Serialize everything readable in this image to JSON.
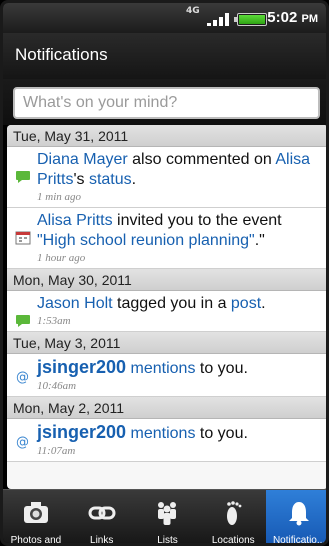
{
  "status": {
    "network": "4G",
    "time": "5:02",
    "ampm": "PM"
  },
  "header": {
    "title": "Notifications"
  },
  "composer": {
    "placeholder": "What's on your mind?"
  },
  "groups": [
    {
      "date": "Tue, May 31, 2011",
      "items": [
        {
          "icon": "comment-icon",
          "actor": "Diana Mayer",
          "t1": " also commented on ",
          "target": "Alisa Pritts",
          "t2": "'s ",
          "obj": "status",
          "t3": ".",
          "ago": "1 min ago"
        },
        {
          "icon": "calendar-icon",
          "actor": "Alisa Pritts",
          "t1": " invited you to the event ",
          "obj": "\"High school reunion planning\"",
          "t3": ".\"",
          "ago": "1 hour ago"
        }
      ]
    },
    {
      "date": "Mon, May 30, 2011",
      "items": [
        {
          "icon": "comment-icon",
          "actor": "Jason Holt",
          "t1": " tagged you in a ",
          "obj": "post",
          "t3": ".",
          "ago": "1:53am"
        }
      ]
    },
    {
      "date": "Tue, May 3, 2011",
      "items": [
        {
          "icon": "mention-icon",
          "actor": "jsinger200",
          "t1": " ",
          "obj": "mentions",
          "t3": " to you.",
          "ago": "10:46am"
        }
      ]
    },
    {
      "date": "Mon, May 2, 2011",
      "items": [
        {
          "icon": "mention-icon",
          "actor": "jsinger200",
          "t1": " ",
          "obj": "mentions",
          "t3": " to you.",
          "ago": "11:07am"
        }
      ]
    }
  ],
  "tabs": [
    {
      "label": "Photos and",
      "icon": "camera-icon"
    },
    {
      "label": "Links",
      "icon": "link-icon"
    },
    {
      "label": "Lists",
      "icon": "people-icon"
    },
    {
      "label": "Locations",
      "icon": "footprint-icon"
    },
    {
      "label": "Notificatio...",
      "icon": "bell-icon",
      "active": true
    }
  ]
}
